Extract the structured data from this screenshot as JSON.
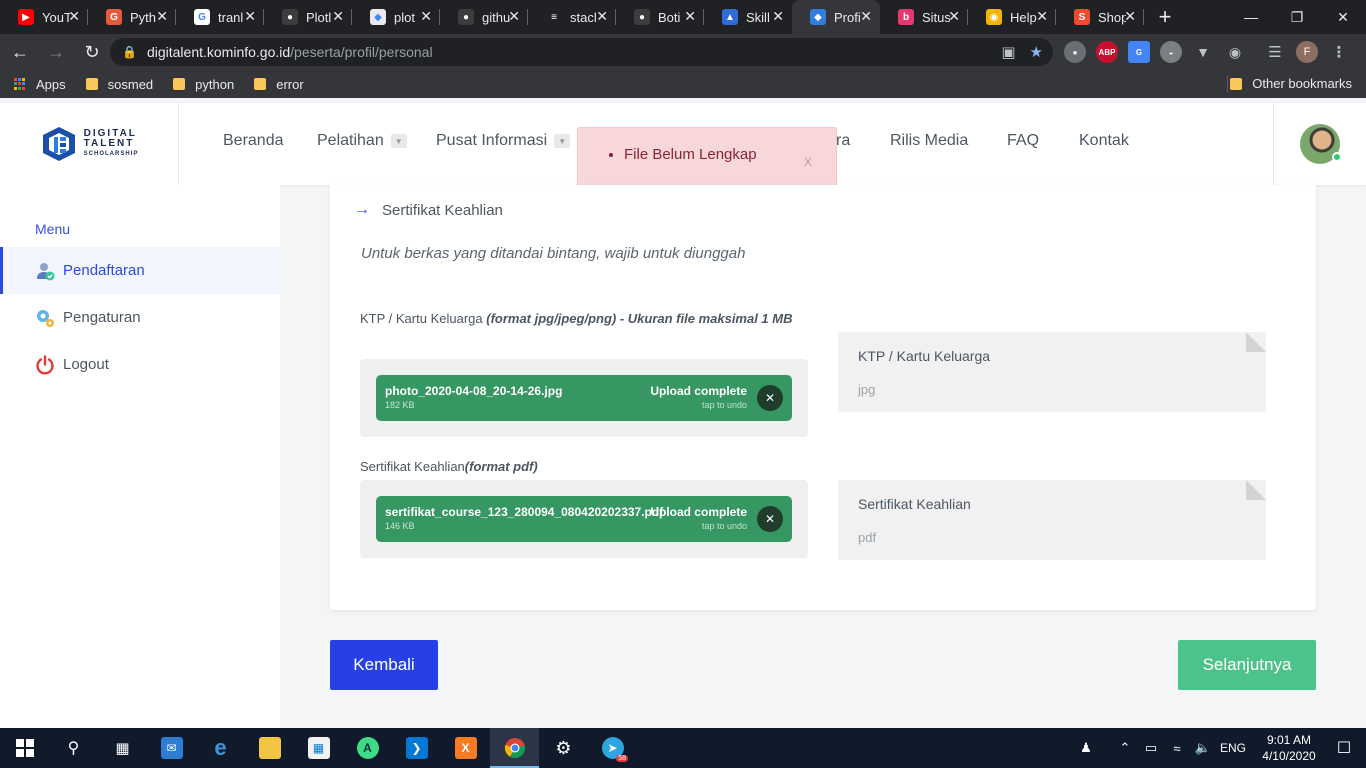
{
  "browser": {
    "tabs": [
      {
        "label": "YouT",
        "fav_color": "#ff0000",
        "fav_glyph": "▶"
      },
      {
        "label": "Pyth",
        "fav_color": "#e8593c",
        "fav_glyph": "G"
      },
      {
        "label": "tranl",
        "fav_color": "#ffffff",
        "fav_glyph": "G"
      },
      {
        "label": "Plotl",
        "fav_color": "#3c3c3c",
        "fav_glyph": "●"
      },
      {
        "label": "plot",
        "fav_color": "#e8eaed",
        "fav_glyph": "◆"
      },
      {
        "label": "githu",
        "fav_color": "#3c3c3c",
        "fav_glyph": "●"
      },
      {
        "label": "stacl",
        "fav_color": "#202124",
        "fav_glyph": "≡"
      },
      {
        "label": "Boti",
        "fav_color": "#3c3c3c",
        "fav_glyph": "●"
      },
      {
        "label": "Skill",
        "fav_color": "#2f6cd8",
        "fav_glyph": "▲"
      },
      {
        "label": "Profi",
        "fav_color": "#2f7ee0",
        "fav_glyph": "◆"
      },
      {
        "label": "Situs",
        "fav_color": "#e43a6f",
        "fav_glyph": "b"
      },
      {
        "label": "Help",
        "fav_color": "#f4b400",
        "fav_glyph": "◉"
      },
      {
        "label": "Shop",
        "fav_color": "#ee4d2d",
        "fav_glyph": "S"
      }
    ],
    "active_tab_index": 9,
    "url_host": "digitalent.kominfo.go.id",
    "url_path": "/peserta/profil/personal",
    "profile_initial": "F",
    "bookmarks": {
      "apps": "Apps",
      "folders": [
        "sosmed",
        "python",
        "error"
      ],
      "other": "Other bookmarks"
    }
  },
  "site": {
    "logo": {
      "line1": "DIGITAL",
      "line2": "TALENT",
      "line3": "SCHOLARSHIP"
    },
    "nav": {
      "beranda": "Beranda",
      "pelatihan": "Pelatihan",
      "pusat_informasi": "Pusat Informasi",
      "mitra_fragment": "ra",
      "rilis_media": "Rilis Media",
      "faq": "FAQ",
      "kontak": "Kontak"
    },
    "alert": {
      "message": "File Belum Lengkap",
      "close": "x"
    }
  },
  "sidebar": {
    "heading": "Menu",
    "items": [
      {
        "label": "Pendaftaran",
        "active": true
      },
      {
        "label": "Pengaturan",
        "active": false
      },
      {
        "label": "Logout",
        "active": false
      }
    ]
  },
  "content": {
    "section_title": "Sertifikat Keahlian",
    "instruction": "Untuk berkas yang ditandai bintang, wajib untuk diunggah",
    "fields": [
      {
        "label": "KTP / Kartu Keluarga",
        "format_note": "(format jpg/jpeg/png) - Ukuran file maksimal 1 MB",
        "file_name": "photo_2020-04-08_20-14-26.jpg",
        "file_size": "182 KB",
        "status": "Upload complete",
        "undo": "tap to undo",
        "preview_title": "KTP / Kartu Keluarga",
        "preview_type": "jpg"
      },
      {
        "label": "Sertifikat Keahlian",
        "format_note": "(format pdf)",
        "file_name": "sertifikat_course_123_280094_080420202337.pdf",
        "file_size": "146 KB",
        "status": "Upload complete",
        "undo": "tap to undo",
        "preview_title": "Sertifikat Keahlian",
        "preview_type": "pdf"
      }
    ],
    "buttons": {
      "back": "Kembali",
      "next": "Selanjutnya"
    }
  },
  "taskbar": {
    "language": "ENG",
    "time": "9:01 AM",
    "date": "4/10/2020",
    "telegram_badge": "58"
  },
  "colors": {
    "primary": "#2740e6",
    "success": "#4cc38a",
    "upload_green": "#369763",
    "alert_bg": "#f8d7da"
  }
}
